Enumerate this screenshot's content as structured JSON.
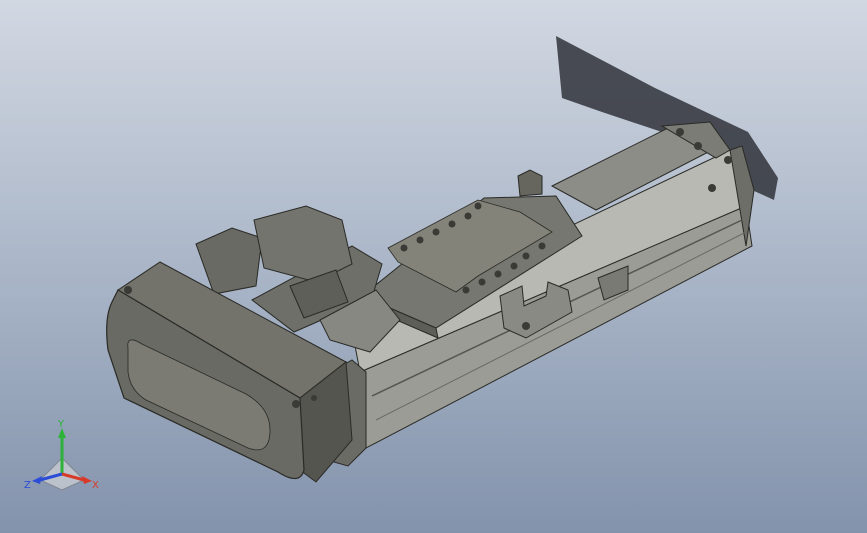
{
  "view": {
    "background_top": "#d2d8e2",
    "background_bottom": "#8393ac"
  },
  "model": {
    "body_color": "#7a7a72",
    "rail_color": "#b3b3ad",
    "dark_color": "#4e4e48",
    "shadow_color": "#2f3238"
  },
  "triad": {
    "x_label": "X",
    "y_label": "Y",
    "z_label": "Z",
    "x_color": "#d83a2a",
    "y_color": "#2db33a",
    "z_color": "#2b4cd6"
  }
}
